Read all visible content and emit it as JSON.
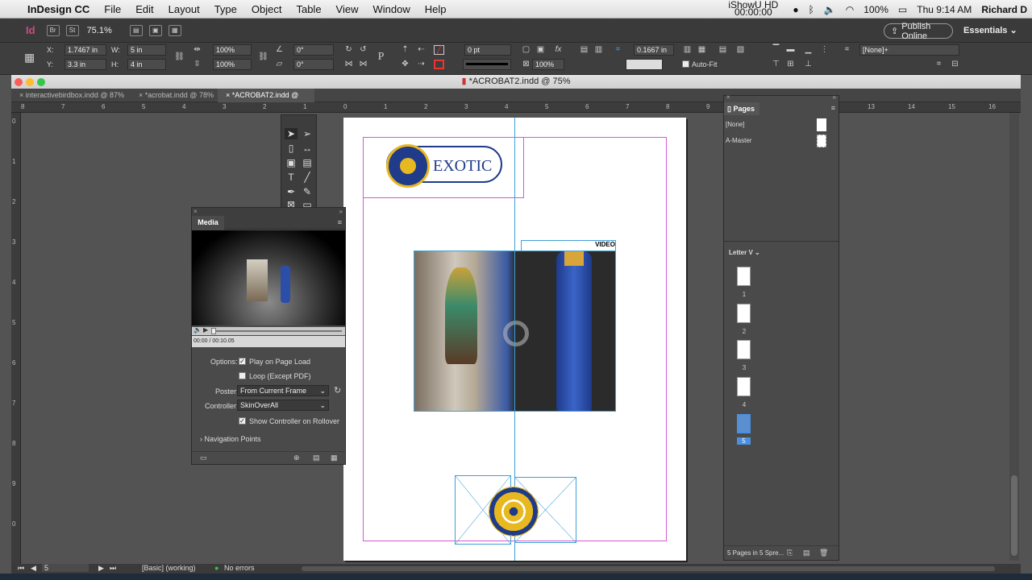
{
  "menubar": {
    "app_name": "InDesign CC",
    "items": [
      "File",
      "Edit",
      "Layout",
      "Type",
      "Object",
      "Table",
      "View",
      "Window",
      "Help"
    ],
    "showu": "iShowU HD",
    "showu_time": "00:00:00",
    "battery": "100%",
    "clock": "Thu 9:14 AM",
    "user": "Richard D"
  },
  "appbar": {
    "zoom": "75.1%",
    "publish_label": "Publish Online",
    "workspace_label": "Essentials"
  },
  "control": {
    "x_label": "X:",
    "x_value": "1.7467 in",
    "y_label": "Y:",
    "y_value": "3.3 in",
    "w_label": "W:",
    "w_value": "5 in",
    "h_label": "H:",
    "h_value": "4 in",
    "scale_x": "100%",
    "scale_y": "100%",
    "angle": "0°",
    "shear": "0°",
    "stroke_weight": "0 pt",
    "opacity": "100%",
    "offset": "0.1667 in",
    "auto_fit": "Auto-Fit",
    "object_style": "[None]+"
  },
  "document": {
    "title": "*ACROBAT2.indd @ 75%",
    "tabs": [
      {
        "label": "interactivebirdbox.indd @ 87%"
      },
      {
        "label": "*acrobat.indd @ 78%"
      },
      {
        "label": "*ACROBAT2.indd @ 75%"
      }
    ],
    "ruler_labels": [
      "8",
      "7",
      "6",
      "5",
      "4",
      "3",
      "2",
      "1",
      "0",
      "1",
      "2",
      "3",
      "4",
      "5",
      "6",
      "7",
      "8",
      "9",
      "10",
      "11",
      "12",
      "13",
      "14",
      "15",
      "16"
    ],
    "vruler_labels": [
      "0",
      "1",
      "2",
      "3",
      "4",
      "5",
      "6",
      "7",
      "8",
      "9",
      "0"
    ]
  },
  "canvas": {
    "logo_text": "EXOTIC",
    "video_label": "VIDEO"
  },
  "media_panel": {
    "title": "Media",
    "time": "00:00 / 00:10.05",
    "options_label": "Options:",
    "play_on_load": "Play on Page Load",
    "play_on_load_checked": "✓",
    "loop": "Loop (Except PDF)",
    "poster_label": "Poster:",
    "poster_value": "From Current Frame",
    "controller_label": "Controller:",
    "controller_value": "SkinOverAll",
    "show_controller": "Show Controller on Rollover",
    "show_controller_checked": "✓",
    "nav_points": "Navigation Points"
  },
  "pages_panel": {
    "title": "Pages",
    "none_label": "[None]",
    "master_label": "A-Master",
    "size_label": "Letter V",
    "pages": [
      {
        "num": "1"
      },
      {
        "num": "2"
      },
      {
        "num": "3"
      },
      {
        "num": "4"
      },
      {
        "num": "5"
      }
    ],
    "footer": "5 Pages in 5 Spre..."
  },
  "status": {
    "page_number": "5",
    "style": "[Basic] (working)",
    "errors": "No errors"
  },
  "colors": {
    "accent_blue": "#3ea0d6",
    "margin_magenta": "#d35ad3",
    "logo_navy": "#1f3b8a",
    "logo_gold": "#e8b820"
  }
}
